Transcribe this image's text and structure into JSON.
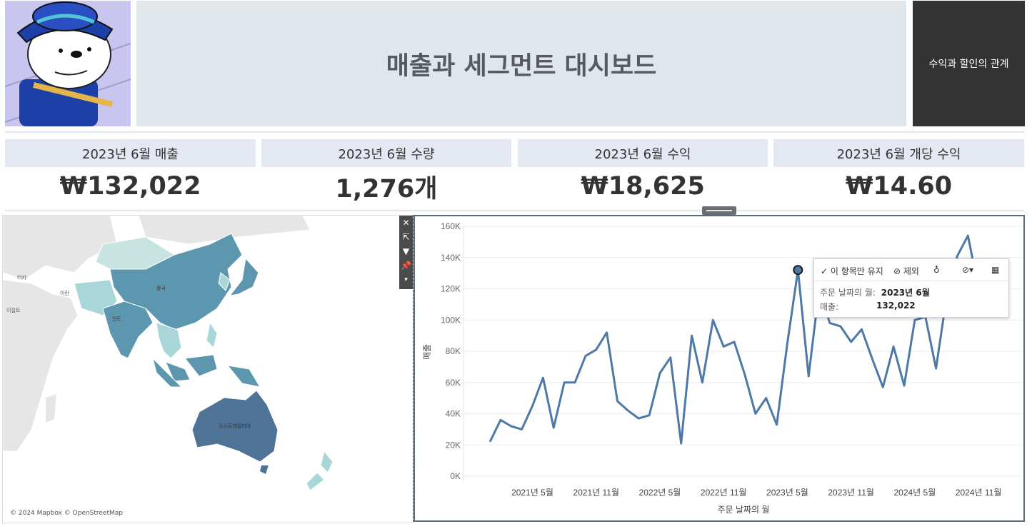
{
  "header": {
    "title": "매출과 세그먼트 대시보드",
    "nav_button": "수익과 할인의 관계"
  },
  "kpis": [
    {
      "label": "2023년 6월 매출",
      "value": "₩132,022"
    },
    {
      "label": "2023년 6월 수량",
      "value": "1,276개"
    },
    {
      "label": "2023년 6월 수익",
      "value": "₩18,625"
    },
    {
      "label": "2023년 6월 개당 수익",
      "value": "₩14.60"
    }
  ],
  "map": {
    "attribution": "© 2024 Mapbox © OpenStreetMap",
    "labels": {
      "china": "중국",
      "india": "인도",
      "australia": "오스트레일리아",
      "iran": "이란",
      "turkey": "터키",
      "egypt": "이집트"
    },
    "toolbar_icons": [
      "close-icon",
      "popout-icon",
      "filter-icon",
      "pin-icon",
      "menu-arrow-icon"
    ],
    "colors": {
      "dark": "#4e7397",
      "mid": "#5d97af",
      "light": "#a9d6d9",
      "lightest": "#c7e4e0"
    }
  },
  "tooltip": {
    "keep_only": "이 항목만 유지",
    "exclude": "제외",
    "field1_label": "주문 날짜의 월:",
    "field1_value": "2023년 6월",
    "field2_label": "매출:",
    "field2_value": "132,022"
  },
  "chart_data": {
    "type": "line",
    "xlabel": "주문 날짜의 월",
    "ylabel": "매출",
    "ylim": [
      0,
      160000
    ],
    "yticks": [
      "0K",
      "20K",
      "40K",
      "60K",
      "80K",
      "100K",
      "120K",
      "140K",
      "160K"
    ],
    "xticks": [
      "2021년 5월",
      "2021년 11월",
      "2022년 5월",
      "2022년 11월",
      "2023년 5월",
      "2023년 11월",
      "2024년 5월",
      "2024년 11월"
    ],
    "x": [
      "2021-01",
      "2021-02",
      "2021-03",
      "2021-04",
      "2021-05",
      "2021-06",
      "2021-07",
      "2021-08",
      "2021-09",
      "2021-10",
      "2021-11",
      "2021-12",
      "2022-01",
      "2022-02",
      "2022-03",
      "2022-04",
      "2022-05",
      "2022-06",
      "2022-07",
      "2022-08",
      "2022-09",
      "2022-10",
      "2022-11",
      "2022-12",
      "2023-01",
      "2023-02",
      "2023-03",
      "2023-04",
      "2023-05",
      "2023-06",
      "2023-07",
      "2023-08",
      "2023-09",
      "2023-10",
      "2023-11",
      "2023-12",
      "2024-01",
      "2024-02",
      "2024-03",
      "2024-04",
      "2024-05",
      "2024-06",
      "2024-07",
      "2024-08",
      "2024-09",
      "2024-10",
      "2024-11",
      "2024-12"
    ],
    "values": [
      22000,
      36000,
      32000,
      30000,
      45000,
      63000,
      31000,
      60000,
      60000,
      77000,
      81000,
      92000,
      48000,
      42000,
      37000,
      39000,
      66000,
      76000,
      21000,
      90000,
      60000,
      100000,
      83000,
      86000,
      65000,
      40000,
      50000,
      33000,
      85000,
      132022,
      64000,
      120000,
      98000,
      96000,
      86000,
      94000,
      75000,
      57000,
      83000,
      58000,
      100000,
      102000,
      69000,
      115000,
      141000,
      154000,
      120000,
      112000
    ],
    "highlight_index": 29,
    "line_color": "#4e79a7",
    "grid": true
  }
}
